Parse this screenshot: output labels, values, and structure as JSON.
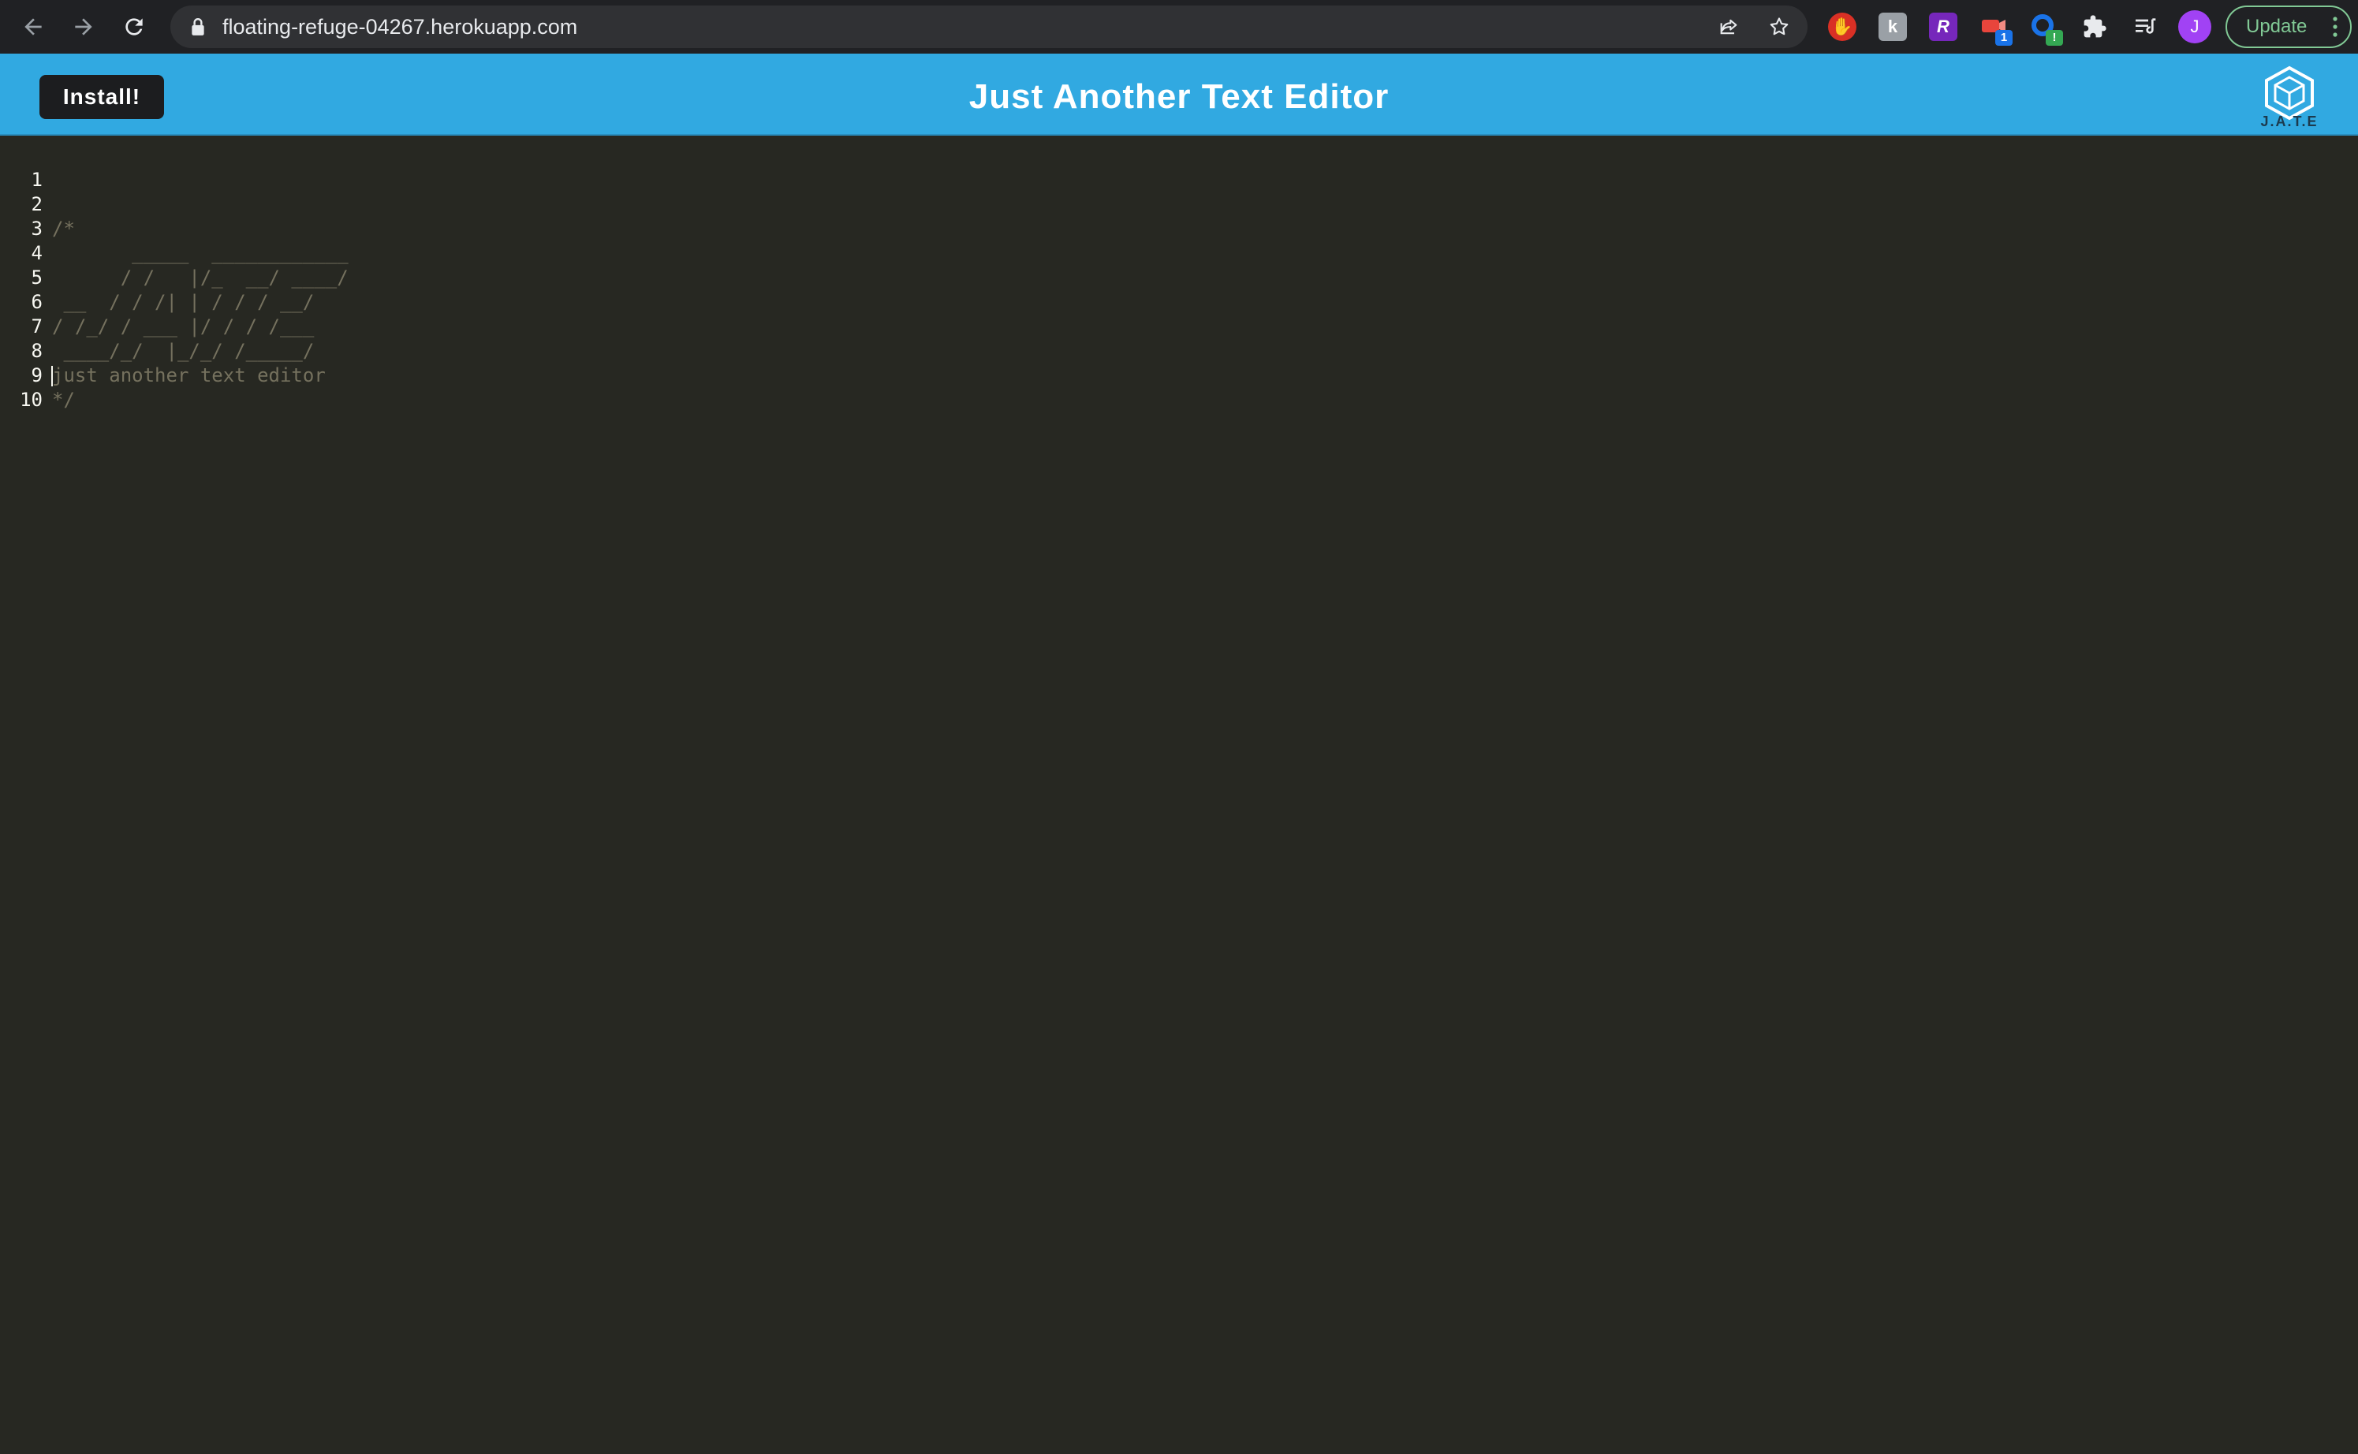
{
  "browser": {
    "url": "floating-refuge-04267.herokuapp.com",
    "update_label": "Update",
    "avatar_initial": "J",
    "extensions": [
      {
        "icon": "stop-hand-extension-icon",
        "color": "#d93025"
      },
      {
        "icon": "k-extension-icon",
        "color": "#9aa0a6",
        "glyph": "k"
      },
      {
        "icon": "r-extension-icon",
        "color": "#7627bb",
        "glyph": "R"
      },
      {
        "icon": "video-extension-icon",
        "color": "#e8453c",
        "badge": "1"
      },
      {
        "icon": "circle-extension-icon",
        "color": "#1a73e8",
        "badge": "!"
      },
      {
        "icon": "puzzle-extensions-icon"
      },
      {
        "icon": "reading-list-icon"
      }
    ]
  },
  "app": {
    "title": "Just Another Text Editor",
    "install_label": "Install!",
    "logo_text": "J.A.T.E",
    "header_color": "#31a9e1"
  },
  "editor": {
    "background": "#272822",
    "lines": [
      {
        "num": "1",
        "text": ""
      },
      {
        "num": "2",
        "text": "/*"
      },
      {
        "num": "3",
        "text": "       _____  ____________"
      },
      {
        "num": "4",
        "text": "      / /   |/_  __/ ____/"
      },
      {
        "num": "5",
        "text": " __  / / /| | / / / __/"
      },
      {
        "num": "6",
        "text": "/ /_/ / ___ |/ / / /___"
      },
      {
        "num": "7",
        "text": " ____/_/  |_/_/ /_____/"
      },
      {
        "num": "8",
        "text": "just another text editor"
      },
      {
        "num": "9",
        "text": "*/"
      },
      {
        "num": "10",
        "text": ""
      }
    ]
  }
}
